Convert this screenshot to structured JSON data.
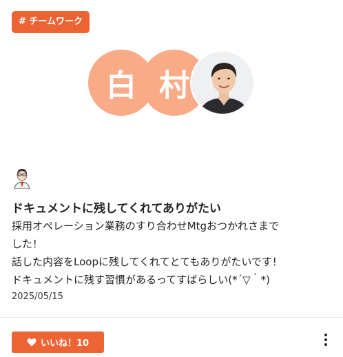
{
  "tag": {
    "label": "# チームワーク"
  },
  "recipients": [
    {
      "initial": "白"
    },
    {
      "initial": "村"
    }
  ],
  "post": {
    "title": "ドキュメントに残してくれてありがたい",
    "lines": [
      "採用オペレーション業務のすり合わせMtgおつかれさまで",
      "した！",
      "話した内容をLoopに残してくれてとてもありがたいです！",
      "ドキュメントに残す習慣があるってすばらしい(*´▽｀*)"
    ],
    "date": "2025/05/15"
  },
  "like": {
    "label": "いいね！10"
  },
  "icons": {
    "heart": "heart-icon",
    "more": "more-vertical-icon"
  },
  "colors": {
    "accent": "#ec6434",
    "avatar_bg": "#f9ab88"
  }
}
